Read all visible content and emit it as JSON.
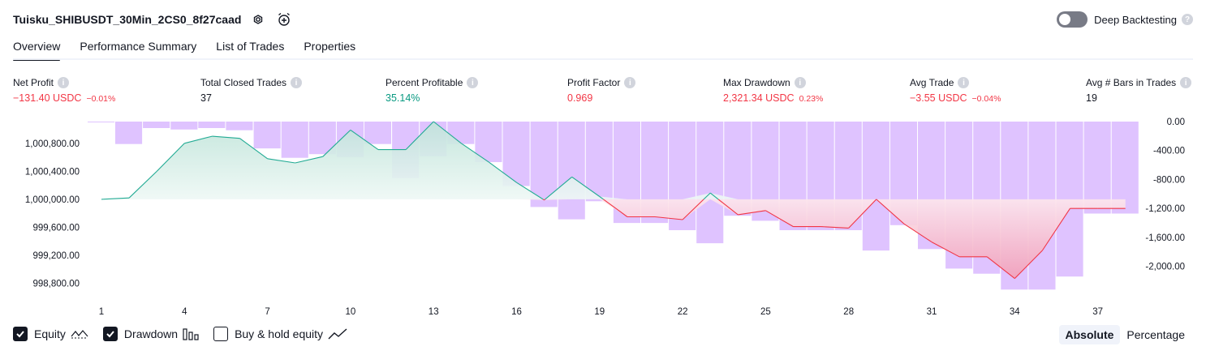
{
  "header": {
    "strategy_title": "Tuisku_SHIBUSDT_30Min_2CS0_8f27caad",
    "settings_icon": "gear-icon",
    "add_alert_icon": "alarm-clock-plus-icon",
    "deep_backtesting_label": "Deep Backtesting",
    "deep_backtesting_enabled": false
  },
  "tabs": [
    {
      "label": "Overview",
      "active": true
    },
    {
      "label": "Performance Summary",
      "active": false
    },
    {
      "label": "List of Trades",
      "active": false
    },
    {
      "label": "Properties",
      "active": false
    }
  ],
  "metrics": [
    {
      "label": "Net Profit",
      "value": "−131.40 USDC",
      "pct": "−0.01%",
      "color": "red"
    },
    {
      "label": "Total Closed Trades",
      "value": "37",
      "pct": "",
      "color": "dark"
    },
    {
      "label": "Percent Profitable",
      "value": "35.14%",
      "pct": "",
      "color": "green"
    },
    {
      "label": "Profit Factor",
      "value": "0.969",
      "pct": "",
      "color": "red"
    },
    {
      "label": "Max Drawdown",
      "value": "2,321.34 USDC",
      "pct": "0.23%",
      "color": "red"
    },
    {
      "label": "Avg Trade",
      "value": "−3.55 USDC",
      "pct": "−0.04%",
      "color": "red"
    },
    {
      "label": "Avg # Bars in Trades",
      "value": "19",
      "pct": "",
      "color": "dark"
    }
  ],
  "colors": {
    "profit": "#22ab94",
    "loss": "#f23645",
    "drawdown_bar": "#d9b8ff",
    "equity_fill_top": "#bfe4d9",
    "loss_fill_bottom": "#f2a0b8"
  },
  "chart_data": {
    "type": "area",
    "x_ticks": [
      "1",
      "4",
      "7",
      "10",
      "13",
      "16",
      "19",
      "22",
      "25",
      "28",
      "31",
      "34",
      "37"
    ],
    "equity": {
      "name": "Equity",
      "x": [
        1,
        2,
        3,
        4,
        5,
        6,
        7,
        8,
        9,
        10,
        11,
        12,
        13,
        14,
        15,
        16,
        17,
        18,
        19,
        20,
        21,
        22,
        23,
        24,
        25,
        26,
        27,
        28,
        29,
        30,
        31,
        32,
        33,
        34,
        35,
        36,
        37,
        38
      ],
      "values": [
        1000000,
        1000020,
        1000400,
        1000800,
        1000900,
        1000870,
        1000580,
        1000520,
        1000610,
        1000990,
        1000710,
        1000710,
        1001110,
        1000800,
        1000530,
        1000240,
        999990,
        1000320,
        1000040,
        999750,
        999750,
        999710,
        1000090,
        999780,
        999840,
        999610,
        999610,
        999590,
        1000000,
        999650,
        999390,
        999180,
        999180,
        998870,
        999270,
        999870,
        999870,
        999870
      ]
    },
    "drawdown": {
      "name": "Drawdown",
      "x": [
        1,
        2,
        3,
        4,
        5,
        6,
        7,
        8,
        9,
        10,
        11,
        12,
        13,
        14,
        15,
        16,
        17,
        18,
        19,
        20,
        21,
        22,
        23,
        24,
        25,
        26,
        27,
        28,
        29,
        30,
        31,
        32,
        33,
        34,
        35,
        36,
        37,
        38
      ],
      "values": [
        -10,
        -310,
        -90,
        -110,
        -90,
        -120,
        -370,
        -500,
        -450,
        -490,
        -310,
        -780,
        -480,
        -310,
        -560,
        -890,
        -1180,
        -1350,
        -1100,
        -1400,
        -1400,
        -1500,
        -1680,
        -1300,
        -1370,
        -1500,
        -1500,
        -1500,
        -1780,
        -1430,
        -1760,
        -2030,
        -2100,
        -2320,
        -2320,
        -2140,
        -1270,
        -1270
      ]
    },
    "y_left_ticks": [
      "1,000,800.00",
      "1,000,400.00",
      "1,000,000.00",
      "999,600.00",
      "999,200.00",
      "998,800.00"
    ],
    "y_left_range": [
      998680,
      1001110
    ],
    "y_right_ticks": [
      "0.00",
      "-400.00",
      "-800.00",
      "-1,200.00",
      "-1,600.00",
      "-2,000.00"
    ],
    "y_right_range": [
      -2350,
      0
    ],
    "baseline": 1000000
  },
  "legend": [
    {
      "label": "Equity",
      "checked": true,
      "icon": "equity-line-icon"
    },
    {
      "label": "Drawdown",
      "checked": true,
      "icon": "bar-chart-icon"
    },
    {
      "label": "Buy & hold equity",
      "checked": false,
      "icon": "trend-line-icon"
    }
  ],
  "mode": {
    "absolute_label": "Absolute",
    "percentage_label": "Percentage",
    "selected": "absolute"
  }
}
